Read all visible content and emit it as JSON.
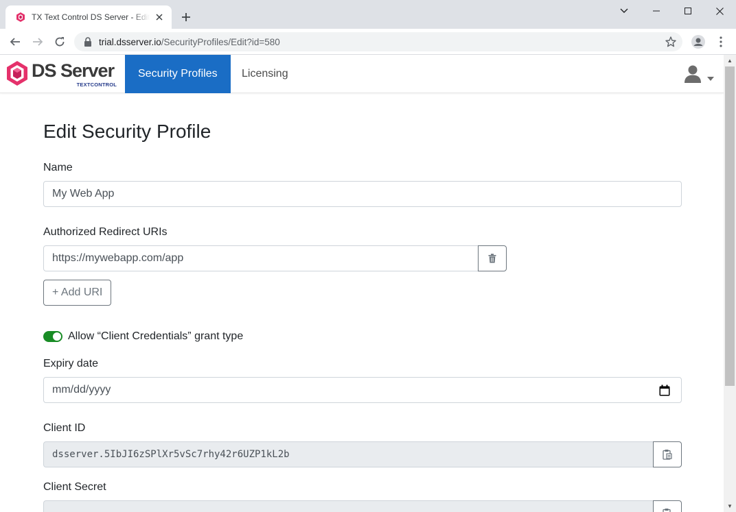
{
  "browser": {
    "tab_title": "TX Text Control DS Server - Edit Security Profile",
    "url_domain": "trial.dsserver.io",
    "url_path": "/SecurityProfiles/Edit?id=580"
  },
  "navbar": {
    "brand_name": "DS Server",
    "brand_sub": "TEXTCONTROL",
    "links": [
      {
        "label": "Security Profiles",
        "active": true
      },
      {
        "label": "Licensing",
        "active": false
      }
    ]
  },
  "form": {
    "title": "Edit Security Profile",
    "name_label": "Name",
    "name_value": "My Web App",
    "redirect_label": "Authorized Redirect URIs",
    "redirect_value": "https://mywebapp.com/app",
    "add_uri_label": "+ Add URI",
    "switch_label": "Allow “Client Credentials” grant type",
    "switch_on": true,
    "expiry_label": "Expiry date",
    "expiry_placeholder": "mm/dd/yyyy",
    "client_id_label": "Client ID",
    "client_id_value": "dsserver.5IbJI6zSPlXr5vSc7rhy42r6UZP1kL2b",
    "client_secret_label": "Client Secret"
  },
  "colors": {
    "accent": "#1a6dc5",
    "switch_on": "#198c25",
    "brand_pink": "#e5316b"
  }
}
